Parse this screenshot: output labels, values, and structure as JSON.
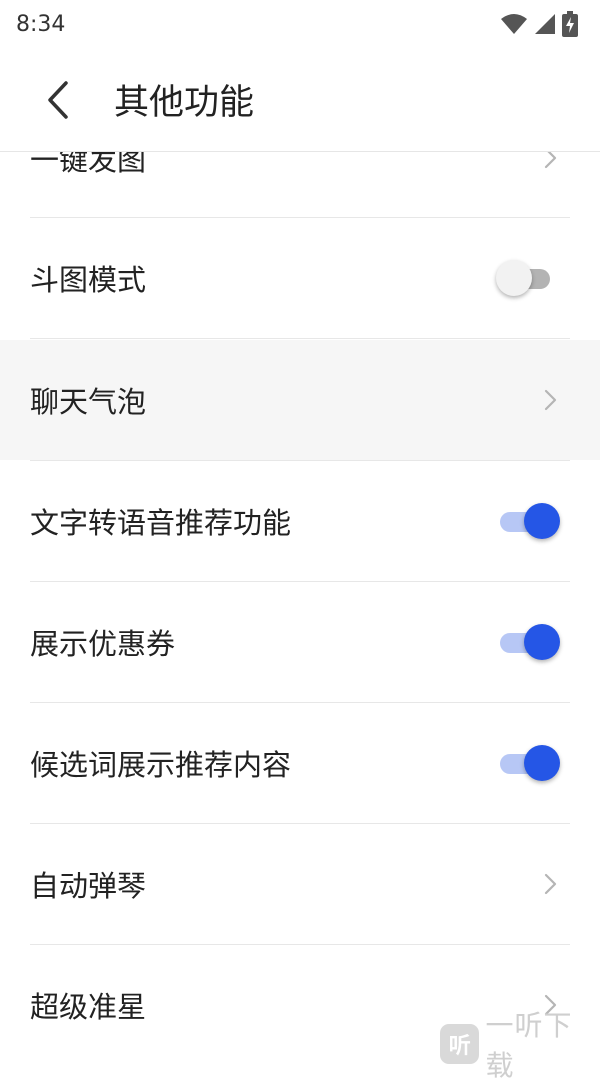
{
  "status_bar": {
    "time": "8:34"
  },
  "header": {
    "title": "其他功能"
  },
  "rows": [
    {
      "label": "一键发图",
      "control": "chevron"
    },
    {
      "label": "斗图模式",
      "control": "switch",
      "checked": false
    },
    {
      "label": "聊天气泡",
      "control": "chevron",
      "highlighted": true
    },
    {
      "label": "文字转语音推荐功能",
      "control": "switch",
      "checked": true
    },
    {
      "label": "展示优惠券",
      "control": "switch",
      "checked": true
    },
    {
      "label": "候选词展示推荐内容",
      "control": "switch",
      "checked": true
    },
    {
      "label": "自动弹琴",
      "control": "chevron"
    },
    {
      "label": "超级准星",
      "control": "chevron"
    }
  ],
  "watermark": {
    "logo_text": "听",
    "text": "一听下载"
  },
  "colors": {
    "accent": "#2556e6",
    "accent_track": "#b7c7f5",
    "off_thumb": "#f2f2f2",
    "off_track": "#b3b3b3"
  }
}
